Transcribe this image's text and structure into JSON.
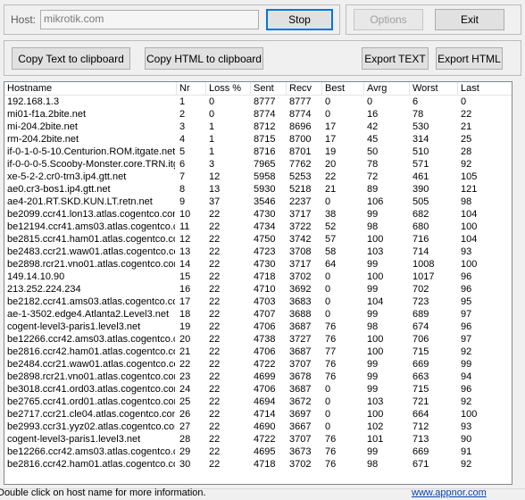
{
  "host": {
    "label": "Host:",
    "value": "mikrotik.com"
  },
  "buttons": {
    "stop": "Stop",
    "options": "Options",
    "exit": "Exit",
    "copy_text": "Copy Text to clipboard",
    "copy_html": "Copy HTML to clipboard",
    "export_text": "Export TEXT",
    "export_html": "Export HTML"
  },
  "table": {
    "columns": [
      "Hostname",
      "Nr",
      "Loss %",
      "Sent",
      "Recv",
      "Best",
      "Avrg",
      "Worst",
      "Last"
    ],
    "rows": [
      [
        "192.168.1.3",
        "1",
        "0",
        "8777",
        "8777",
        "0",
        "0",
        "6",
        "0"
      ],
      [
        "mi01-f1a.2bite.net",
        "2",
        "0",
        "8774",
        "8774",
        "0",
        "16",
        "78",
        "22"
      ],
      [
        "mi-204.2bite.net",
        "3",
        "1",
        "8712",
        "8696",
        "17",
        "42",
        "530",
        "21"
      ],
      [
        "rm-204.2bite.net",
        "4",
        "1",
        "8715",
        "8700",
        "17",
        "45",
        "314",
        "25"
      ],
      [
        "if-0-1-0-5-10.Centurion.ROM.itgate.net",
        "5",
        "1",
        "8716",
        "8701",
        "19",
        "50",
        "510",
        "28"
      ],
      [
        "if-0-0-0-5.Scooby-Monster.core.TRN.itgate.net",
        "6",
        "3",
        "7965",
        "7762",
        "20",
        "78",
        "571",
        "92"
      ],
      [
        "xe-5-2-2.cr0-trn3.ip4.gtt.net",
        "7",
        "12",
        "5958",
        "5253",
        "22",
        "72",
        "461",
        "105"
      ],
      [
        "ae0.cr3-bos1.ip4.gtt.net",
        "8",
        "13",
        "5930",
        "5218",
        "21",
        "89",
        "390",
        "121"
      ],
      [
        "ae4-201.RT.SKD.KUN.LT.retn.net",
        "9",
        "37",
        "3546",
        "2237",
        "0",
        "106",
        "505",
        "98"
      ],
      [
        "be2099.ccr41.lon13.atlas.cogentco.com",
        "10",
        "22",
        "4730",
        "3717",
        "38",
        "99",
        "682",
        "104"
      ],
      [
        "be12194.ccr41.ams03.atlas.cogentco.com",
        "11",
        "22",
        "4734",
        "3722",
        "52",
        "98",
        "680",
        "100"
      ],
      [
        "be2815.ccr41.ham01.atlas.cogentco.com",
        "12",
        "22",
        "4750",
        "3742",
        "57",
        "100",
        "716",
        "104"
      ],
      [
        "be2483.ccr21.waw01.atlas.cogentco.com",
        "13",
        "22",
        "4723",
        "3708",
        "58",
        "103",
        "714",
        "93"
      ],
      [
        "be2898.rcr21.vno01.atlas.cogentco.com",
        "14",
        "22",
        "4730",
        "3717",
        "64",
        "99",
        "1008",
        "100"
      ],
      [
        "149.14.10.90",
        "15",
        "22",
        "4718",
        "3702",
        "0",
        "100",
        "1017",
        "96"
      ],
      [
        "213.252.224.234",
        "16",
        "22",
        "4710",
        "3692",
        "0",
        "99",
        "702",
        "96"
      ],
      [
        "be2182.ccr41.ams03.atlas.cogentco.com",
        "17",
        "22",
        "4703",
        "3683",
        "0",
        "104",
        "723",
        "95"
      ],
      [
        "ae-1-3502.edge4.Atlanta2.Level3.net",
        "18",
        "22",
        "4707",
        "3688",
        "0",
        "99",
        "689",
        "97"
      ],
      [
        "cogent-level3-paris1.level3.net",
        "19",
        "22",
        "4706",
        "3687",
        "76",
        "98",
        "674",
        "96"
      ],
      [
        "be12266.ccr42.ams03.atlas.cogentco.com",
        "20",
        "22",
        "4738",
        "3727",
        "76",
        "100",
        "706",
        "97"
      ],
      [
        "be2816.ccr42.ham01.atlas.cogentco.com",
        "21",
        "22",
        "4706",
        "3687",
        "77",
        "100",
        "715",
        "92"
      ],
      [
        "be2484.ccr21.waw01.atlas.cogentco.com",
        "22",
        "22",
        "4722",
        "3707",
        "76",
        "99",
        "669",
        "99"
      ],
      [
        "be2898.rcr21.vno01.atlas.cogentco.com",
        "23",
        "22",
        "4699",
        "3678",
        "76",
        "99",
        "663",
        "94"
      ],
      [
        "be3018.ccr41.ord03.atlas.cogentco.com",
        "24",
        "22",
        "4706",
        "3687",
        "0",
        "99",
        "715",
        "96"
      ],
      [
        "be2765.ccr41.ord01.atlas.cogentco.com",
        "25",
        "22",
        "4694",
        "3672",
        "0",
        "103",
        "721",
        "92"
      ],
      [
        "be2717.ccr21.cle04.atlas.cogentco.com",
        "26",
        "22",
        "4714",
        "3697",
        "0",
        "100",
        "664",
        "100"
      ],
      [
        "be2993.ccr31.yyz02.atlas.cogentco.com",
        "27",
        "22",
        "4690",
        "3667",
        "0",
        "102",
        "712",
        "93"
      ],
      [
        "cogent-level3-paris1.level3.net",
        "28",
        "22",
        "4722",
        "3707",
        "76",
        "101",
        "713",
        "90"
      ],
      [
        "be12266.ccr42.ams03.atlas.cogentco.com",
        "29",
        "22",
        "4695",
        "3673",
        "76",
        "99",
        "669",
        "91"
      ],
      [
        "be2816.ccr42.ham01.atlas.cogentco.com",
        "30",
        "22",
        "4718",
        "3702",
        "76",
        "98",
        "671",
        "92"
      ]
    ]
  },
  "status": {
    "text": "Double click on host name for more information.",
    "link": "www.appnor.com"
  }
}
